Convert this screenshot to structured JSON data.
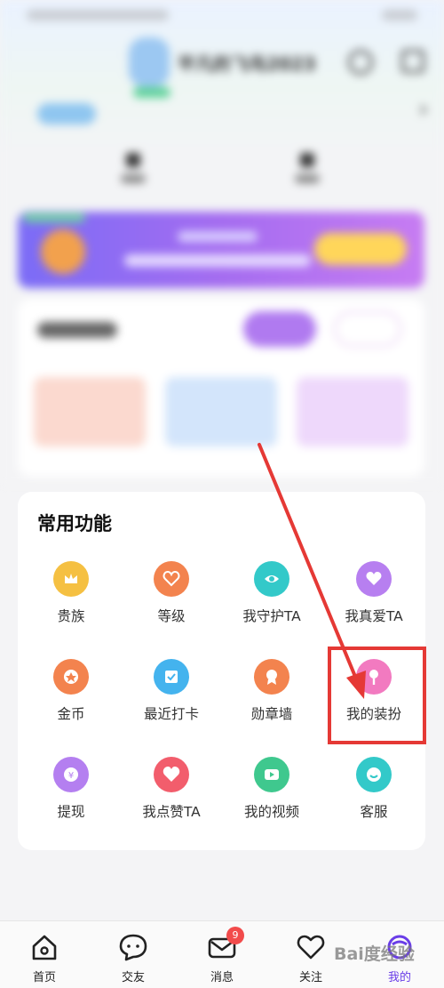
{
  "profile": {
    "name": "平凡的飞鸟2023"
  },
  "common_functions": {
    "title": "常用功能",
    "items": [
      {
        "label": "贵族",
        "icon": "crown-icon",
        "color": "#f5c042"
      },
      {
        "label": "等级",
        "icon": "heart-badge-icon",
        "color": "#f3834e"
      },
      {
        "label": "我守护TA",
        "icon": "shield-eye-icon",
        "color": "#33c9c9"
      },
      {
        "label": "我真爱TA",
        "icon": "double-heart-icon",
        "color": "#b77ff0"
      },
      {
        "label": "金币",
        "icon": "coin-icon",
        "color": "#f3834e"
      },
      {
        "label": "最近打卡",
        "icon": "checkin-icon",
        "color": "#44b3ee"
      },
      {
        "label": "勋章墙",
        "icon": "medal-icon",
        "color": "#f3834e"
      },
      {
        "label": "我的装扮",
        "icon": "dress-up-icon",
        "color": "#f27ac0"
      },
      {
        "label": "提现",
        "icon": "withdraw-icon",
        "color": "#b47ff0"
      },
      {
        "label": "我点赞TA",
        "icon": "heart-icon",
        "color": "#f25d6c"
      },
      {
        "label": "我的视频",
        "icon": "video-icon",
        "color": "#3fc88e"
      },
      {
        "label": "客服",
        "icon": "customer-service-icon",
        "color": "#33c9c9"
      }
    ]
  },
  "bottom_nav": {
    "items": [
      {
        "label": "首页",
        "icon": "home-icon"
      },
      {
        "label": "交友",
        "icon": "chat-bubble-icon"
      },
      {
        "label": "消息",
        "icon": "mail-icon",
        "badge": "9"
      },
      {
        "label": "关注",
        "icon": "heart-outline-icon"
      },
      {
        "label": "我的",
        "icon": "profile-icon"
      }
    ]
  },
  "watermark": "Bai度经验",
  "annotation": {
    "color": "#e53935"
  }
}
